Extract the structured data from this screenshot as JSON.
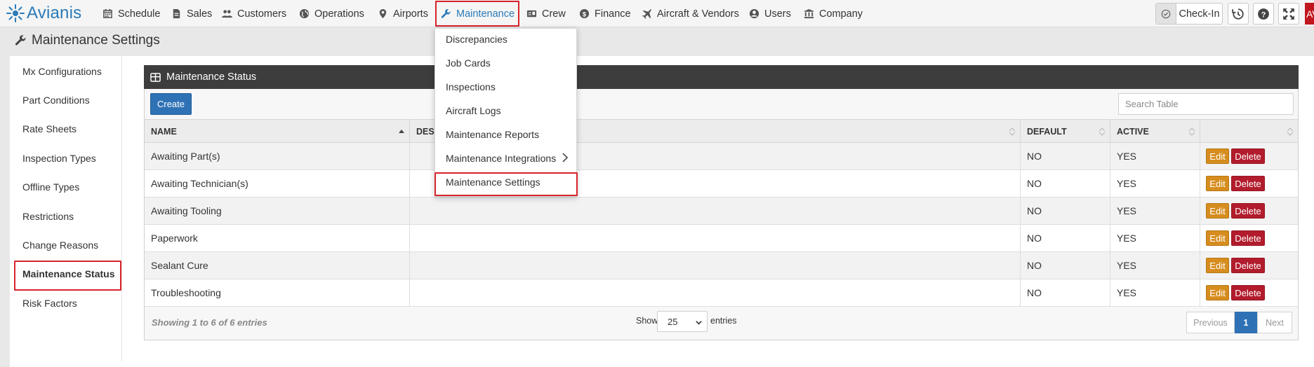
{
  "nav": {
    "brand": "Avianis",
    "items": [
      {
        "label": "Schedule",
        "icon": "calendar-icon"
      },
      {
        "label": "Sales",
        "icon": "document-icon"
      },
      {
        "label": "Customers",
        "icon": "users-icon"
      },
      {
        "label": "Operations",
        "icon": "globe-icon"
      },
      {
        "label": "Airports",
        "icon": "map-marker-icon"
      },
      {
        "label": "Maintenance",
        "icon": "wrench-icon"
      },
      {
        "label": "Crew",
        "icon": "id-card-icon"
      },
      {
        "label": "Finance",
        "icon": "dollar-icon"
      },
      {
        "label": "Aircraft & Vendors",
        "icon": "plane-icon"
      },
      {
        "label": "Users",
        "icon": "user-icon"
      },
      {
        "label": "Company",
        "icon": "bank-icon"
      }
    ],
    "active": "Maintenance",
    "checkin_label": "Check-In",
    "corner_text": "AV"
  },
  "page": {
    "title": "Maintenance Settings"
  },
  "sidebar": {
    "items": [
      "Mx Configurations",
      "Part Conditions",
      "Rate Sheets",
      "Inspection Types",
      "Offline Types",
      "Restrictions",
      "Change Reasons",
      "Maintenance Status",
      "Risk Factors"
    ],
    "active": "Maintenance Status"
  },
  "box": {
    "title": "Maintenance Status",
    "create_label": "Create",
    "search_placeholder": "Search Table"
  },
  "table": {
    "columns": [
      "NAME",
      "DESC",
      "DEFAULT",
      "ACTIVE",
      ""
    ],
    "rows": [
      {
        "name": "Awaiting Part(s)",
        "description": "",
        "default": "NO",
        "active": "YES"
      },
      {
        "name": "Awaiting Technician(s)",
        "description": "",
        "default": "NO",
        "active": "YES"
      },
      {
        "name": "Awaiting Tooling",
        "description": "",
        "default": "NO",
        "active": "YES"
      },
      {
        "name": "Paperwork",
        "description": "",
        "default": "NO",
        "active": "YES"
      },
      {
        "name": "Sealant Cure",
        "description": "",
        "default": "NO",
        "active": "YES"
      },
      {
        "name": "Troubleshooting",
        "description": "",
        "default": "NO",
        "active": "YES"
      }
    ],
    "edit_label": "Edit",
    "delete_label": "Delete"
  },
  "footer": {
    "info": "Showing 1 to 6 of 6 entries",
    "show_label": "Show",
    "page_size": "25",
    "entries_label": "entries",
    "previous": "Previous",
    "current_page": "1",
    "next": "Next"
  },
  "dropdown": {
    "items": [
      "Discrepancies",
      "Job Cards",
      "Inspections",
      "Aircraft Logs",
      "Maintenance Reports",
      "Maintenance Integrations",
      "Maintenance Settings"
    ],
    "highlighted": "Maintenance Settings"
  },
  "colors": {
    "brand": "#2a7ab8",
    "highlight_border": "#d8232a",
    "header_dark": "#3d3d3d",
    "primary": "#2e72b5",
    "edit": "#d68d1e",
    "delete": "#b21c2c"
  }
}
